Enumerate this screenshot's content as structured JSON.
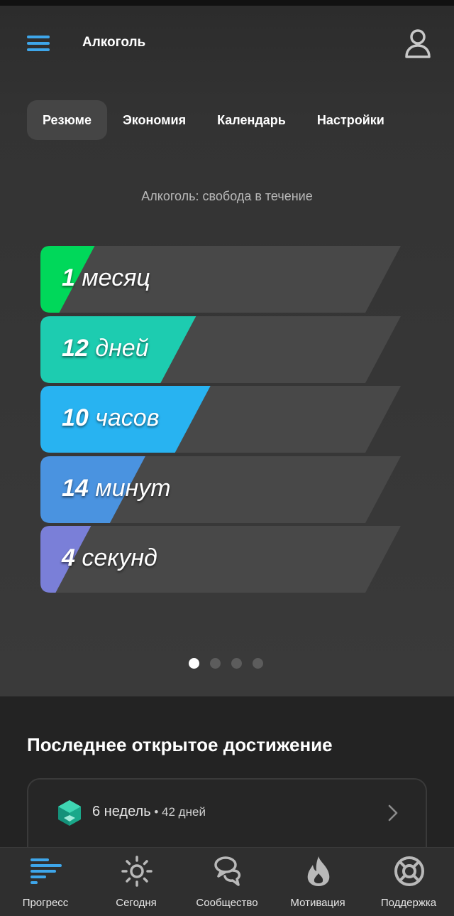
{
  "app": {
    "title": "Алкоголь"
  },
  "tabs": [
    {
      "label": "Резюме",
      "active": true
    },
    {
      "label": "Экономия",
      "active": false
    },
    {
      "label": "Календарь",
      "active": false
    },
    {
      "label": "Настройки",
      "active": false
    }
  ],
  "summary": {
    "subtitle": "Алкоголь: свобода в течение",
    "counters": [
      {
        "value": "1",
        "unit": "месяц",
        "color": "#00d85a",
        "fill": 0.15
      },
      {
        "value": "12",
        "unit": "дней",
        "color": "#1dccb0",
        "fill": 0.43
      },
      {
        "value": "10",
        "unit": "часов",
        "color": "#28b3f1",
        "fill": 0.47
      },
      {
        "value": "14",
        "unit": "минут",
        "color": "#4a93e0",
        "fill": 0.29
      },
      {
        "value": "4",
        "unit": "секунд",
        "color": "#7a7fd8",
        "fill": 0.14
      }
    ]
  },
  "pager": {
    "count": 4,
    "active": 0
  },
  "achievement": {
    "section_title": "Последнее открытое достижение",
    "name": "6 недель",
    "separator": " • ",
    "detail": "42 дней",
    "icon": "hexagon-badge-icon"
  },
  "bottom_nav": [
    {
      "label": "Прогресс",
      "icon": "progress-bars-icon",
      "active": true
    },
    {
      "label": "Сегодня",
      "icon": "sun-icon",
      "active": false
    },
    {
      "label": "Сообщество",
      "icon": "chat-bubbles-icon",
      "active": false
    },
    {
      "label": "Мотивация",
      "icon": "flame-icon",
      "active": false
    },
    {
      "label": "Поддержка",
      "icon": "lifebuoy-icon",
      "active": false
    }
  ],
  "colors": {
    "accent": "#3ea6ea",
    "background": "#333333"
  }
}
